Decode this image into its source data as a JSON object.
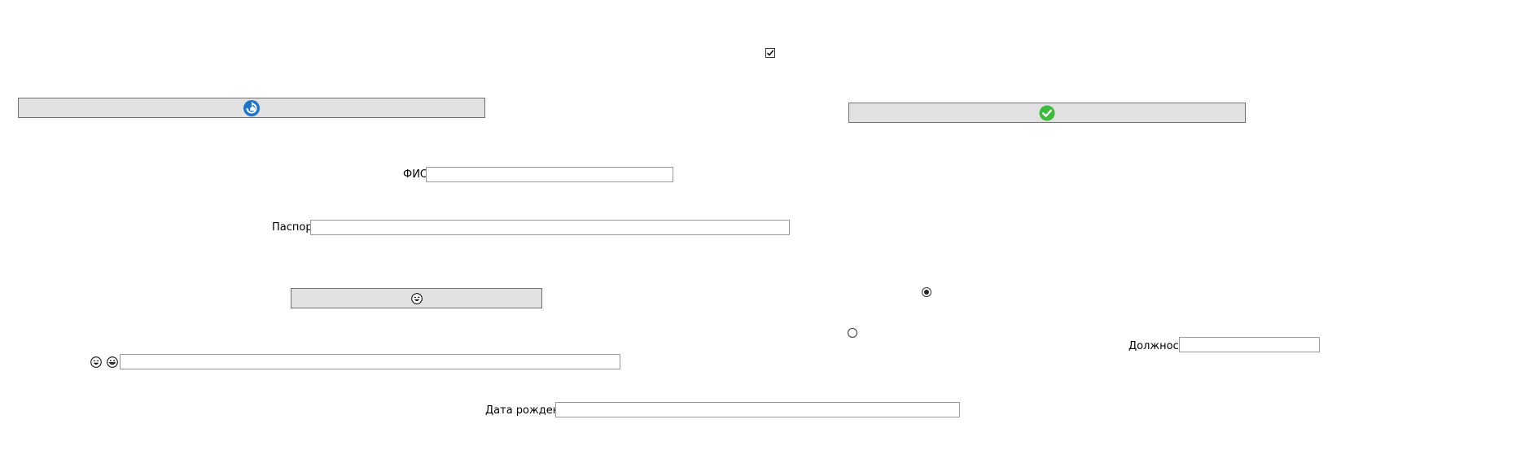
{
  "form": {
    "fio_label": "ФИО",
    "fio_value": "",
    "passport_label": "Паспорт",
    "passport_value": "",
    "position_label": "Должность",
    "position_value": "",
    "birthdate_label": "Дата рождения",
    "birthdate_value": "",
    "emoji_field_value": ""
  },
  "checkbox": {
    "checked": true
  },
  "radios": [
    {
      "selected": true
    },
    {
      "selected": false
    }
  ],
  "icons": {
    "refresh_button": "refresh-icon",
    "confirm_button": "check-circle-icon",
    "emoji_button": "laughing-face-icon",
    "emoji_label_1": "laughing-face-icon",
    "emoji_label_2": "grinning-face-icon"
  },
  "colors": {
    "button_bg": "#e1e1e1",
    "refresh_blue": "#1e74c8",
    "confirm_green": "#3cba3c"
  }
}
